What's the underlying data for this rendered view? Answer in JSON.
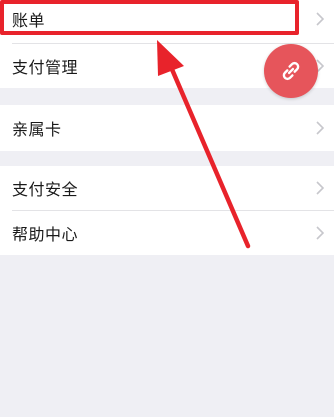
{
  "menu": {
    "group1": [
      {
        "label": "账单"
      },
      {
        "label": "支付管理"
      }
    ],
    "group2": [
      {
        "label": "亲属卡"
      }
    ],
    "group3": [
      {
        "label": "支付安全"
      },
      {
        "label": "帮助中心"
      }
    ]
  },
  "icons": {
    "chevron": "chevron-right-icon",
    "fab": "link-icon"
  },
  "colors": {
    "background": "#efeff4",
    "row_background": "#ffffff",
    "annotation_red": "#e8232b",
    "fab_red": "#e6555b",
    "chevron": "#c7c7cc"
  }
}
